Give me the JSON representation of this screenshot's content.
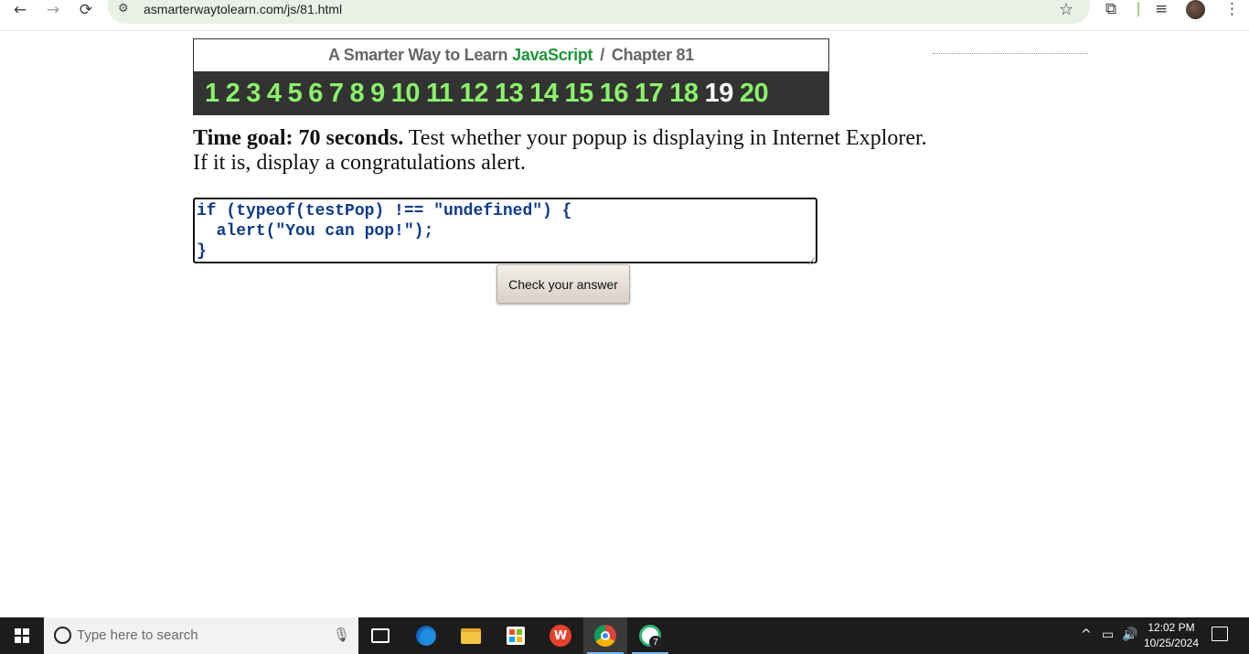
{
  "browser": {
    "back_icon": "←",
    "forward_icon": "→",
    "reload_icon": "⟳",
    "site_info_icon": "⚙",
    "url": "asmarterwaytolearn.com/js/81.html",
    "star_icon": "☆",
    "extensions_icon": "⧉",
    "media_icon": "≡",
    "menu_icon": "⋮"
  },
  "header": {
    "prefix": "A Smarter Way to Learn",
    "brand": "JavaScript",
    "separator": "/",
    "chapter": "Chapter 81",
    "chapters": [
      "1",
      "2",
      "3",
      "4",
      "5",
      "6",
      "7",
      "8",
      "9",
      "10",
      "11",
      "12",
      "13",
      "14",
      "15",
      "16",
      "17",
      "18",
      "19",
      "20"
    ],
    "current_chapter": "19",
    "chapter_color": "#8bf26b",
    "brand_color": "#1e9638"
  },
  "exercise": {
    "goal_label": "Time goal: 70 seconds.",
    "instructions": " Test whether your popup is displaying in Internet Explorer. If it is, display a congratulations alert.",
    "code": "if (typeof(testPop) !== \"undefined\") {\n  alert(\"You can pop!\");\n}",
    "check_button": "Check your answer"
  },
  "taskbar": {
    "search_placeholder": "Type here to search",
    "mic_icon": "🎙",
    "wps_label": "W",
    "chat_badge": "7",
    "tray_up_icon": "^",
    "battery_icon": "▭",
    "volume_icon": "🔊",
    "time": "12:02 PM",
    "date": "10/25/2024"
  }
}
